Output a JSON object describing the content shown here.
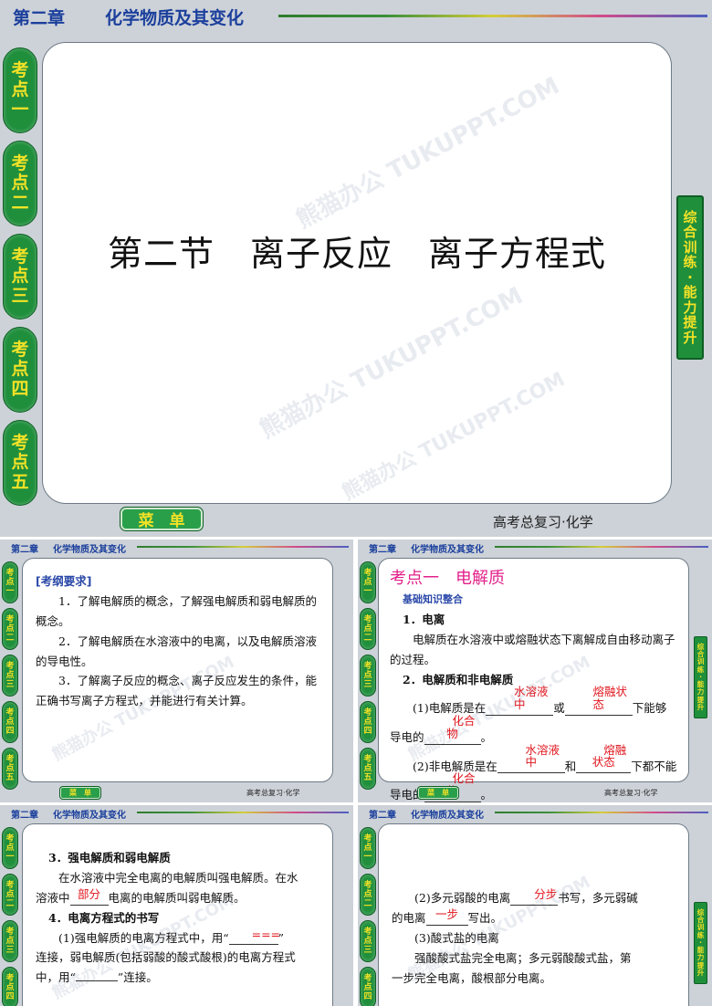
{
  "header": {
    "chapter": "第二章",
    "chapter_title": "化学物质及其变化"
  },
  "tabs": [
    [
      "考",
      "点",
      "一"
    ],
    [
      "考",
      "点",
      "二"
    ],
    [
      "考",
      "点",
      "三"
    ],
    [
      "考",
      "点",
      "四"
    ],
    [
      "考",
      "点",
      "五"
    ]
  ],
  "side_label": [
    "综",
    "合",
    "训",
    "练",
    "·",
    "能",
    "力",
    "提",
    "升"
  ],
  "menu_label": "菜　单",
  "footer_text": "高考总复习·化学",
  "watermark": "熊猫办公 TUKUPPT.COM",
  "slide1": {
    "title": "第二节　离子反应　离子方程式"
  },
  "slide2": {
    "heading": "[考纲要求]",
    "items": [
      "1．了解电解质的概念，了解强电解质和弱电解质的概念。",
      "2．了解电解质在水溶液中的电离，以及电解质溶液的导电性。",
      "3．了解离子反应的概念、离子反应发生的条件，能正确书写离子方程式，并能进行有关计算。"
    ]
  },
  "slide3": {
    "title": "考点一　电解质",
    "subtitle": "基础知识整合",
    "h1": "1．电离",
    "p1": "电解质在水溶液中或熔融状态下离解成自由移动离子的过程。",
    "h2": "2．电解质和非电解质",
    "s1a": "(1)电解质是在",
    "s1b": "或",
    "s1c": "下能够",
    "s1d": "导电的",
    "s1e": "。",
    "a1": "水溶液中",
    "a2": "熔融状态",
    "a3": "化合物",
    "s2a": "(2)非电解质是在",
    "s2b": "和",
    "s2c": "下都不能",
    "s2d": "导电的",
    "s2e": "。",
    "b1": "水溶液中",
    "b2": "熔融状态",
    "b3": "化合物"
  },
  "slide4": {
    "h3": "3．强电解质和弱电解质",
    "p1": "在水溶液中完全电离的电解质叫强电解质。在水",
    "p2a": "溶液中",
    "p2ans": "部分",
    "p2b": "电离的电解质叫弱电解质。",
    "h4": "4．电离方程式的书写",
    "p3a": "(1)强电解质的电离方程式中，用“",
    "p3ans": "===",
    "p3b": "”",
    "p4": "连接，弱电解质(包括弱酸的酸式酸根)的电离方程式",
    "p5a": "中，用“",
    "p5b": "”连接。"
  },
  "slide5": {
    "p1a": "(2)多元弱酸的电离",
    "p1ans": "分步",
    "p1b": "书写，多元弱碱",
    "p2a": "的电离",
    "p2ans": "一步",
    "p2b": "写出。",
    "p3": "(3)酸式盐的电离",
    "p4": "强酸酸式盐完全电离；多元弱酸酸式盐，第",
    "p5": "一步完全电离，酸根部分电离。"
  }
}
